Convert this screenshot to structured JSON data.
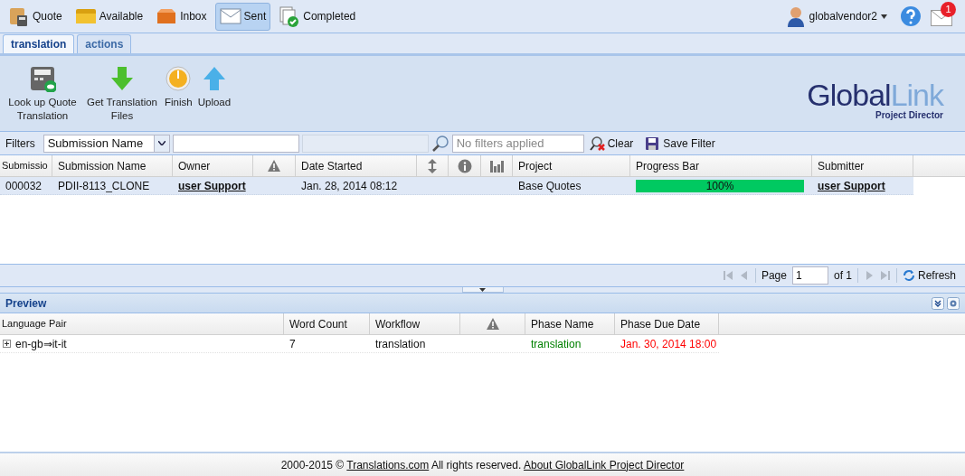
{
  "nav": [
    {
      "label": "Quote",
      "selected": false
    },
    {
      "label": "Available",
      "selected": false
    },
    {
      "label": "Inbox",
      "selected": false
    },
    {
      "label": "Sent",
      "selected": true
    },
    {
      "label": "Completed",
      "selected": false
    }
  ],
  "user": {
    "name": "globalvendor2",
    "unread": "1"
  },
  "tabs": [
    {
      "label": "translation",
      "selected": true
    },
    {
      "label": "actions",
      "selected": false
    }
  ],
  "actions": [
    "Look up Quote Translation",
    "Get Translation Files",
    "Finish",
    "Upload"
  ],
  "logo": {
    "name_dark": "Global",
    "name_light": "Link",
    "subtitle": "Project Director"
  },
  "filters": {
    "label": "Filters",
    "field": "Submission Name",
    "status_placeholder": "No filters applied",
    "clear": "Clear",
    "save": "Save Filter"
  },
  "table": {
    "columns": [
      {
        "kind": "text",
        "label": "Submissio"
      },
      {
        "kind": "text",
        "label": "Submission Name"
      },
      {
        "kind": "text",
        "label": "Owner"
      },
      {
        "kind": "icon"
      },
      {
        "kind": "text",
        "label": "Date Started"
      },
      {
        "kind": "icon"
      },
      {
        "kind": "icon"
      },
      {
        "kind": "icon"
      },
      {
        "kind": "text",
        "label": "Project"
      },
      {
        "kind": "text",
        "label": "Progress Bar"
      },
      {
        "kind": "text",
        "label": "Submitter"
      }
    ],
    "rows": [
      {
        "selected": true,
        "cells": [
          {
            "kind": "text",
            "text": "000032"
          },
          {
            "kind": "text",
            "text": "PDII-8113_CLONE"
          },
          {
            "kind": "link",
            "text": "user Support"
          },
          {
            "kind": "empty"
          },
          {
            "kind": "text",
            "text": "Jan. 28, 2014 08:12"
          },
          {
            "kind": "empty"
          },
          {
            "kind": "empty"
          },
          {
            "kind": "empty"
          },
          {
            "kind": "text",
            "text": "Base Quotes"
          },
          {
            "kind": "progress",
            "level": 1,
            "reading": "100%"
          },
          {
            "kind": "link",
            "text": "user Support"
          }
        ]
      }
    ]
  },
  "pager": {
    "label": "Page",
    "page": "1",
    "total": "of 1",
    "refresh": "Refresh"
  },
  "preview": {
    "title": "Preview",
    "columns": [
      {
        "kind": "text",
        "label": "Language Pair"
      },
      {
        "kind": "text",
        "label": "Word Count"
      },
      {
        "kind": "text",
        "label": "Workflow"
      },
      {
        "kind": "icon"
      },
      {
        "kind": "text",
        "label": "Phase Name"
      },
      {
        "kind": "text",
        "label": "Phase Due Date"
      }
    ],
    "rows": [
      {
        "expanded": false,
        "cells": [
          {
            "text": "en-gb⇒it-it"
          },
          {
            "text": "7"
          },
          {
            "text": "translation"
          },
          {},
          {
            "text": "translation",
            "color": "#008000"
          },
          {
            "text": "Jan. 30, 2014 18:00",
            "color": "#ff0000"
          }
        ]
      }
    ]
  },
  "footer": [
    {
      "kind": "text",
      "text": "2000-2015 ©"
    },
    {
      "kind": "link",
      "text": "Translations.com"
    },
    {
      "kind": "text",
      "text": "All rights reserved."
    },
    {
      "kind": "link",
      "text": "About GlobalLink Project Director"
    }
  ]
}
